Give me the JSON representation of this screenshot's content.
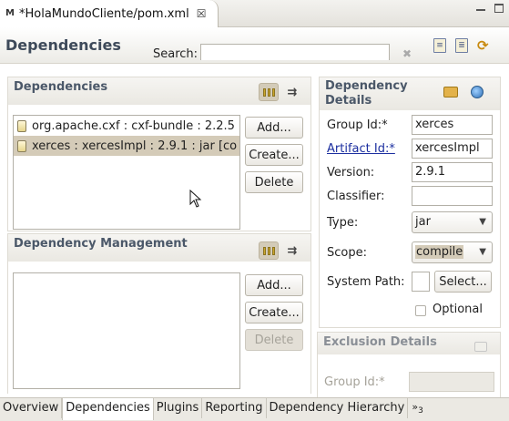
{
  "editor_tab": {
    "title": "*HolaMundoCliente/pom.xml",
    "icon": "maven-file-icon",
    "close": "☒"
  },
  "header": {
    "title": "Dependencies",
    "search_label": "Search:",
    "search_value": ""
  },
  "dependencies": {
    "title": "Dependencies",
    "items": [
      {
        "label": "org.apache.cxf : cxf-bundle : 2.2.5",
        "selected": false
      },
      {
        "label": "xerces : xercesImpl : 2.9.1 : jar [co",
        "selected": true
      }
    ],
    "buttons": {
      "add": "Add...",
      "create": "Create...",
      "delete": "Delete"
    }
  },
  "dependency_management": {
    "title": "Dependency Management",
    "items": [],
    "buttons": {
      "add": "Add...",
      "create": "Create...",
      "delete": "Delete"
    }
  },
  "details": {
    "title_line1": "Dependency",
    "title_line2": "Details",
    "group_id_label": "Group Id:*",
    "group_id_value": "xerces",
    "artifact_id_label": "Artifact Id:*",
    "artifact_id_value": "xercesImpl",
    "version_label": "Version:",
    "version_value": "2.9.1",
    "classifier_label": "Classifier:",
    "classifier_value": "",
    "type_label": "Type:",
    "type_value": "jar",
    "scope_label": "Scope:",
    "scope_value": "compile",
    "system_path_label": "System Path:",
    "system_path_value": "",
    "select_button": "Select...",
    "optional_label": "Optional",
    "optional_checked": false
  },
  "exclusion": {
    "title": "Exclusion Details",
    "group_id_label": "Group Id:*",
    "group_id_value": ""
  },
  "bottom_tabs": [
    {
      "label": "Overview",
      "active": false
    },
    {
      "label": "Dependencies",
      "active": true
    },
    {
      "label": "Plugins",
      "active": false
    },
    {
      "label": "Reporting",
      "active": false
    },
    {
      "label": "Dependency Hierarchy",
      "active": false
    }
  ],
  "more_tabs": {
    "chevron": "»",
    "count": "3"
  }
}
